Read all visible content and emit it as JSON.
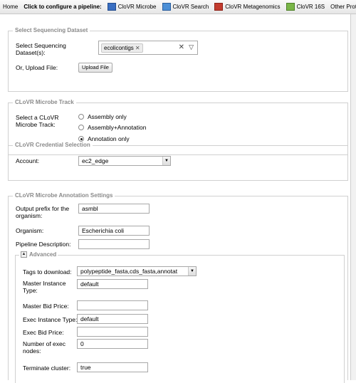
{
  "toolbar": {
    "home": "Home",
    "prompt": "Click to configure a pipeline:",
    "microbe": "CloVR Microbe",
    "search": "CloVR Search",
    "metagenomics": "CloVR Metagenomics",
    "s16": "CloVR 16S",
    "other": "Other Protocols"
  },
  "sequencing": {
    "legend": "Select Sequencing Dataset",
    "select_label": "Select Sequencing Dataset(s):",
    "selected_chip": "ecolicontigs",
    "upload_label": "Or, Upload File:",
    "upload_button": "Upload File"
  },
  "track": {
    "legend": "CLoVR Microbe Track",
    "label": "Select a CLoVR Microbe Track:",
    "options": [
      "Assembly only",
      "Assembly+Annotation",
      "Annotation only"
    ],
    "selected": "Annotation only"
  },
  "credential": {
    "legend": "CLoVR Credential Selection",
    "account_label": "Account:",
    "account_value": "ec2_edge"
  },
  "annotation": {
    "legend": "CLoVR Microbe Annotation Settings",
    "output_prefix_label": "Output prefix for the organism:",
    "output_prefix_value": "asmbl",
    "organism_label": "Organism:",
    "organism_value": "Escherichia coli",
    "description_label": "Pipeline Description:",
    "description_value": "",
    "advanced": {
      "legend": "Advanced",
      "tags_label": "Tags to download:",
      "tags_value": "polypeptide_fasta,cds_fasta,annotat",
      "master_type_label": "Master Instance Type:",
      "master_type_value": "default",
      "master_bid_label": "Master Bid Price:",
      "master_bid_value": "",
      "exec_type_label": "Exec Instance Type:",
      "exec_type_value": "default",
      "exec_bid_label": "Exec Bid Price:",
      "exec_bid_value": "",
      "exec_nodes_label": "Number of exec nodes:",
      "exec_nodes_value": "0",
      "terminate_label": "Terminate cluster:",
      "terminate_value": "true"
    }
  }
}
